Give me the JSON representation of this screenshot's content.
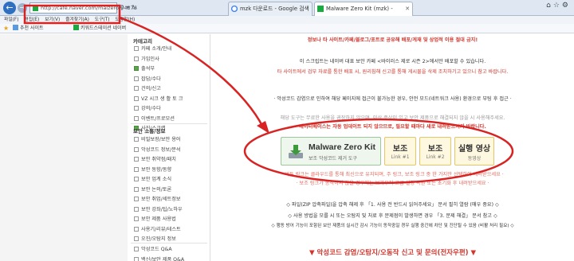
{
  "browser": {
    "url": "http://cafe.naver.com/malzero/94376",
    "tabs": [
      {
        "label": "mzk 다운로드 - Google 검색"
      },
      {
        "label": "Malware Zero Kit (mzk) -"
      }
    ],
    "menu": [
      "파일(F)",
      "편집(E)",
      "보기(V)",
      "즐겨찾기(A)",
      "도구(T)",
      "도움말(H)"
    ],
    "favorites": [
      {
        "label": "추천 사이트"
      },
      {
        "label": "키워드스테이션 네이버"
      }
    ]
  },
  "sidebar": {
    "section1_title": "카테고리",
    "items1": [
      {
        "label": "카페 소개/안내",
        "checked": false
      },
      {
        "label": "가입인사",
        "checked": false
      },
      {
        "label": "출석부",
        "checked": true
      },
      {
        "label": "잡담/수다",
        "checked": false
      },
      {
        "label": "건의/신고",
        "checked": false
      },
      {
        "label": "VZ 시크 생 활 토 크",
        "checked": false
      },
      {
        "label": "강의/수다",
        "checked": false
      },
      {
        "label": "이벤트/프로모션",
        "checked": false
      },
      {
        "label": "사진/스크랩",
        "checked": true
      }
    ],
    "section2_title": "보안 소통/정보",
    "items2": [
      {
        "label": "비밀보장/보안 용어",
        "checked": false
      },
      {
        "label": "악성코드 정보/분석",
        "checked": false
      },
      {
        "label": "보안 취약점/패치",
        "checked": false
      },
      {
        "label": "보안 동향/동향",
        "checked": false
      },
      {
        "label": "보안 업계 소식",
        "checked": false
      },
      {
        "label": "보안 논의/토론",
        "checked": false
      },
      {
        "label": "보안 취업/세트정보",
        "checked": false
      },
      {
        "label": "보안 강좌/팁/노하우",
        "checked": false
      },
      {
        "label": "보안 제품 사용법",
        "checked": false
      },
      {
        "label": "사용기/리뷰/테스트",
        "checked": false
      },
      {
        "label": "오진/오탐지 정보",
        "checked": false
      }
    ],
    "items3": [
      {
        "label": "악성코드 Q&A",
        "checked": false
      },
      {
        "label": "백신/보안 제품 Q&A",
        "checked": false
      }
    ]
  },
  "main": {
    "top_line": "정보나 타 사이트/카페/블로그/포트로 공유해 배포/게재 및 상업적 이용 절대 금지!",
    "line2": "이 스크립트는 네이버 대표 보안 카페 <바이러스 제로 시즌 2>에서만 배포할 수 있습니다.",
    "line3": "타 사이트에서 검부 자료를 통한 배포 시, 원리침해 신고를 통해 게시물을 삭제 조치하기고 있으니 참고 바랍니다.",
    "line4": "· 악성코드 감염으로 인하여 해당 페이지에 접근이 불가능한 경우, 안전 모드(네트워크 사용) 환경으로 부팅 후 접근 ·",
    "line5": "해당 도구는 무료한 사용을 권장하지 않으며, 이상 증상이 있고 보안 제품으로 해결되지 않을 시 사용해주세요.",
    "line6": "데이터베이스는 자동 업데이트 되지 않으므로, 필요할 때마다 새로 내려받으시기 바랍니다.",
    "mzk_button": {
      "title": "Malware Zero Kit",
      "sub": "보조 악성코드 제거 도구"
    },
    "buttons": [
      {
        "title": "보조",
        "sub": "Link #1"
      },
      {
        "title": "보조",
        "sub": "Link #2"
      },
      {
        "title": "실행 영상",
        "sub": "동영상"
      }
    ],
    "dl_note1": "· 버튼 링크는 클라우드를 통해 최신으로 유지되며, 주 링크, 보조 링크 중 한 가지만 선택하여 내려받으세요 ·",
    "dl_note2": "· 보조 링크가 동작하지 않을 경우에는 브라우저 고급 설정 복원 또는 초기화 후 내려받으세요 ·",
    "bullet1": "◇ 파일(ZIP 압축파일)을 압축 해제 후 「1. 사용 전 반드시 읽어주세요」 문서 필히 열람 (매우 중요) ◇",
    "bullet2": "◇ 사용 방법을 모를 시 또는 오탐지 및 처료 후 문제점이 발생하면 경우 「3. 문제 해결」 문서 참고 ◇",
    "bullet3": "◇ 행동 방어 기능이 포함된 보안 제품의 실시간 감시 기능이 동작중일 경우 실행 중간에 차단 및 진단될 수 있음 (비활 처리 필요) ◇",
    "footer": "▼ 악성코드 감염/오탐지/오동작 신고 및 문의(전자우편) ▼"
  },
  "colors": {
    "accent_red": "#d4352b",
    "annotation": "#d92323",
    "mzk_green": "#eef6ee"
  }
}
